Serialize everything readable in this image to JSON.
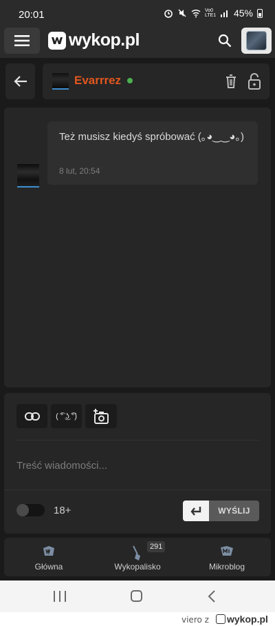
{
  "status_bar": {
    "time": "20:01",
    "network_label": "Vo0 LTE1",
    "battery": "45%"
  },
  "app_bar": {
    "logo_text": "wykop.pl"
  },
  "conversation": {
    "username": "Evarrrez",
    "username_color": "#e2571e",
    "online_color": "#4caf50"
  },
  "messages": [
    {
      "text": "Też musisz kiedyś spróbować (｡◕‿‿◕｡)",
      "time": "8 lut, 20:54"
    }
  ],
  "composer": {
    "lenny_label": "( ͡° ͜ʖ ͡°)",
    "placeholder": "Treść wiadomości...",
    "adult_toggle_label": "18+",
    "adult_toggle_on": false,
    "send_label": "WYŚLIJ"
  },
  "bottom_nav": {
    "items": [
      {
        "label": "Główna",
        "icon": "wykop-logo-icon"
      },
      {
        "label": "Wykopalisko",
        "icon": "shovel-icon",
        "badge": "291"
      },
      {
        "label": "Mikroblog",
        "icon": "mikroblog-icon"
      }
    ]
  },
  "watermark": {
    "user": "viero z",
    "site": "wykop.pl"
  }
}
